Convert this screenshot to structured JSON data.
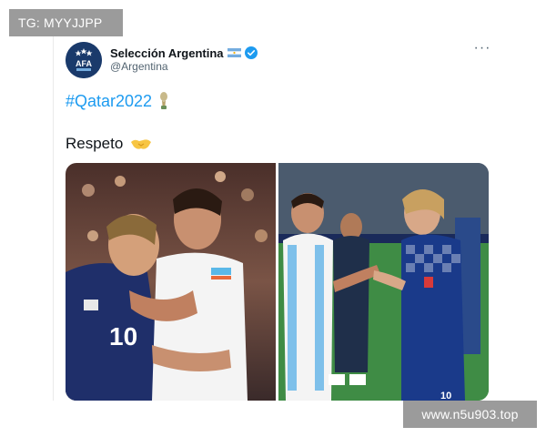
{
  "watermarks": {
    "top_left": "TG: MYYJJPP",
    "bottom_right": "www.n5u903.top"
  },
  "tweet": {
    "author": {
      "display_name": "Selección Argentina",
      "handle": "@Argentina",
      "avatar_text": "AFA",
      "flag": "argentina-flag-emoji",
      "verified": true
    },
    "more_icon": "···",
    "hashtag": "#Qatar2022",
    "hashtag_emoji": "trophy-emoji",
    "text": "Respeto",
    "text_emoji": "handshake-emoji",
    "media": [
      {
        "description_icon": "photo-hug",
        "jersey_number": "10"
      },
      {
        "description_icon": "photo-handshake",
        "jersey_number": "10"
      }
    ]
  },
  "colors": {
    "link_blue": "#1d9bf0",
    "verified_blue": "#1d9bf0",
    "watermark_bg": "#9b9b9b",
    "avatar_navy": "#1a3a6b"
  }
}
